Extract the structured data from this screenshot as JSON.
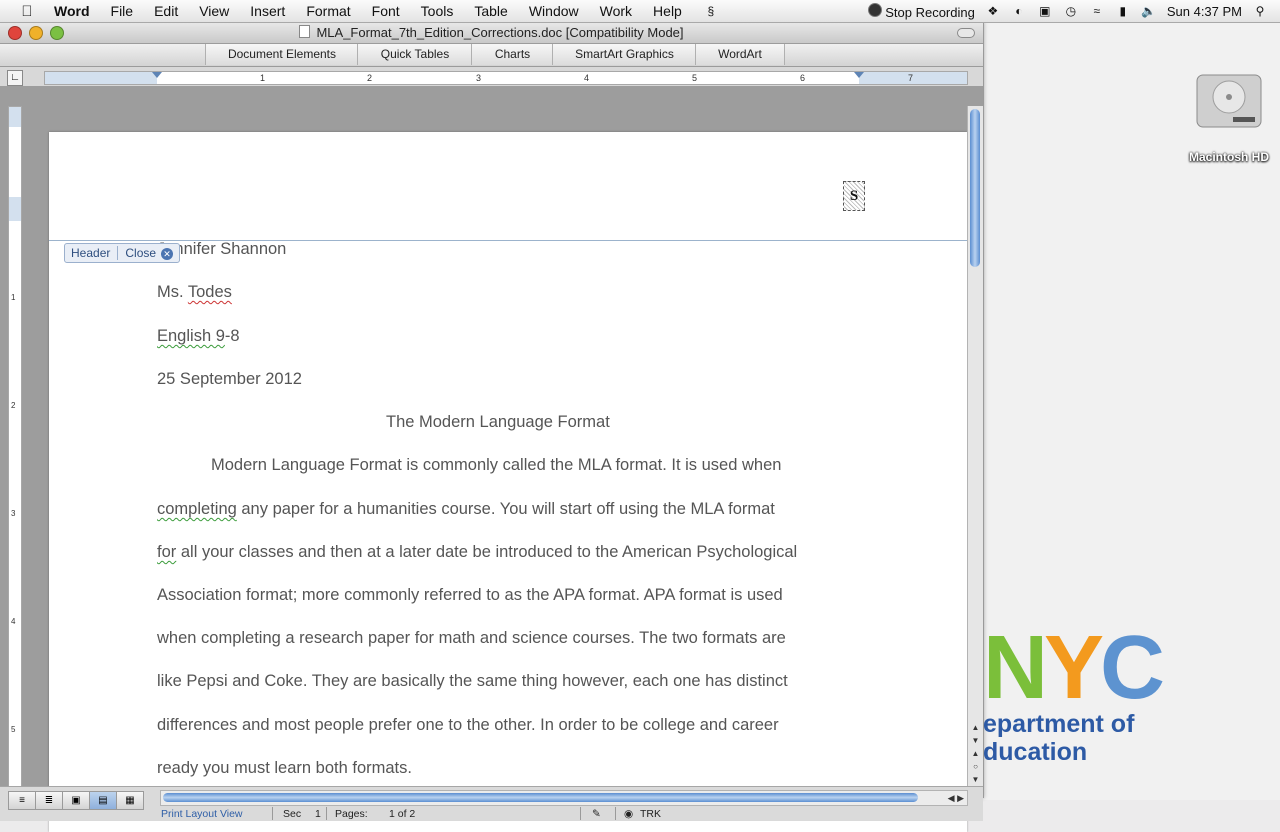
{
  "menubar": {
    "app_name": "Word",
    "items": [
      "File",
      "Edit",
      "View",
      "Insert",
      "Format",
      "Font",
      "Tools",
      "Table",
      "Window",
      "Work",
      "Help"
    ],
    "stop_recording": "Stop Recording",
    "clock": "Sun 4:37 PM"
  },
  "window": {
    "title": "MLA_Format_7th_Edition_Corrections.doc [Compatibility Mode]",
    "ribbon_tabs": [
      "Document Elements",
      "Quick Tables",
      "Charts",
      "SmartArt Graphics",
      "WordArt"
    ]
  },
  "ruler": {
    "numbers": [
      "1",
      "2",
      "3",
      "4",
      "5",
      "6",
      "7"
    ]
  },
  "vruler": {
    "numbers": [
      "1",
      "2",
      "3",
      "4",
      "5"
    ]
  },
  "document": {
    "header_label": "Header",
    "close_label": "Close",
    "header_mark": "S",
    "lines": [
      {
        "text": "Jennifer Shannon"
      },
      {
        "text_a": "Ms. ",
        "squig": "Todes"
      },
      {
        "squig_g": "English  9",
        "text_b": "-8"
      },
      {
        "text": "25 September 2012"
      },
      {
        "text": "The Modern Language Format"
      },
      {
        "text": "Modern Language Format is commonly called the MLA format.  It is used when"
      },
      {
        "squig_g": "completing",
        "text_b": " any paper for a humanities course.  You will start off using the MLA format"
      },
      {
        "squig_g": "for",
        "text_b": " all your classes and then at a later date be introduced to the American Psychological"
      },
      {
        "text": "Association format; more commonly referred to as the APA format.  APA format is used"
      },
      {
        "text": "when completing a research paper for math and science courses.   The two formats are"
      },
      {
        "text": "like Pepsi and Coke.  They are basically the same thing however, each one has distinct"
      },
      {
        "text": "differences and most people prefer one to the other.  In order to be college and career"
      },
      {
        "text": "ready you must learn both formats."
      }
    ]
  },
  "status": {
    "view_name": "Print Layout View",
    "sec_label": "Sec",
    "sec_value": "1",
    "pages_label": "Pages:",
    "pages_value": "1 of 2",
    "trk": "TRK"
  },
  "desktop": {
    "drive_label": "Macintosh HD",
    "logo_text": "NYC",
    "dept_line1": "epartment of",
    "dept_line2": "ducation",
    "logo_colors": [
      "#7bbf3a",
      "#f39a1e",
      "#5d93d0"
    ]
  }
}
